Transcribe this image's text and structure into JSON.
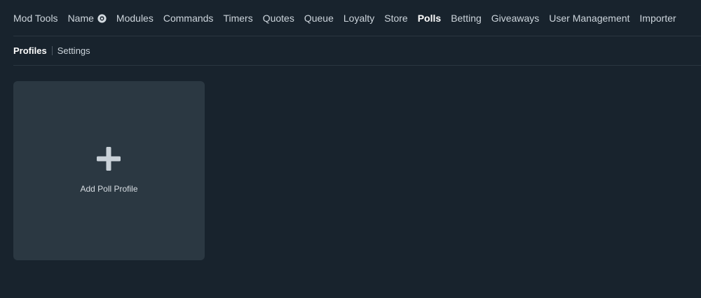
{
  "topnav": {
    "items": [
      {
        "label": "Mod Tools"
      },
      {
        "label": "Name",
        "icon": "gear-icon"
      },
      {
        "label": "Modules"
      },
      {
        "label": "Commands"
      },
      {
        "label": "Timers"
      },
      {
        "label": "Quotes"
      },
      {
        "label": "Queue"
      },
      {
        "label": "Loyalty"
      },
      {
        "label": "Store"
      },
      {
        "label": "Polls",
        "active": true
      },
      {
        "label": "Betting"
      },
      {
        "label": "Giveaways"
      },
      {
        "label": "User Management"
      },
      {
        "label": "Importer"
      }
    ]
  },
  "subnav": {
    "profiles_label": "Profiles",
    "settings_label": "Settings",
    "active": "Profiles"
  },
  "add_card": {
    "icon": "plus-icon",
    "label": "Add Poll Profile"
  },
  "colors": {
    "background": "#18232d",
    "card": "#2b3842",
    "divider": "#2a3640",
    "text": "#cdd5dc",
    "active_text": "#ffffff"
  }
}
